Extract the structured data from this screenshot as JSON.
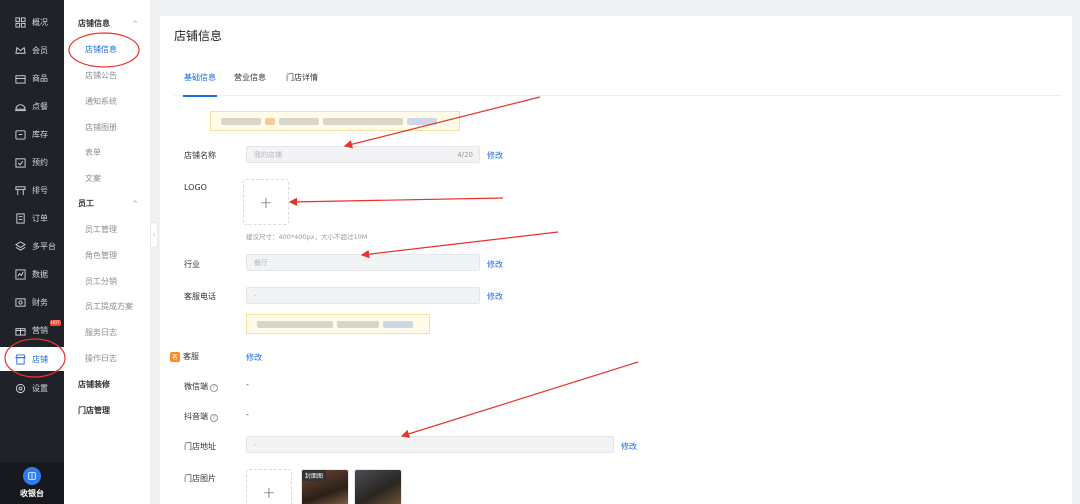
{
  "rail": {
    "items": [
      {
        "label": "概况",
        "icon": "grid-icon"
      },
      {
        "label": "会员",
        "icon": "crown-icon"
      },
      {
        "label": "商品",
        "icon": "box-icon"
      },
      {
        "label": "点餐",
        "icon": "dish-icon"
      },
      {
        "label": "库存",
        "icon": "warehouse-icon"
      },
      {
        "label": "预约",
        "icon": "calendar-check-icon"
      },
      {
        "label": "排号",
        "icon": "queue-icon"
      },
      {
        "label": "订单",
        "icon": "order-icon"
      },
      {
        "label": "多平台",
        "icon": "layers-icon"
      },
      {
        "label": "数据",
        "icon": "chart-icon"
      },
      {
        "label": "财务",
        "icon": "money-icon"
      },
      {
        "label": "营销",
        "icon": "gift-icon",
        "badge": "HOT"
      },
      {
        "label": "店铺",
        "icon": "store-icon",
        "active": true
      },
      {
        "label": "设置",
        "icon": "gear-icon"
      }
    ],
    "cashier_label": "收银台"
  },
  "submenu": {
    "group1": "店铺信息",
    "group1_items": [
      "店铺信息",
      "店铺公告",
      "通知系统",
      "店铺图册",
      "表单",
      "文案"
    ],
    "group2": "员工",
    "group2_items": [
      "员工管理",
      "角色管理",
      "员工分销",
      "员工提成方案",
      "服务日志",
      "操作日志"
    ],
    "extra": [
      "店铺装修",
      "门店管理"
    ]
  },
  "page": {
    "title": "店铺信息",
    "tabs": [
      "基础信息",
      "营业信息",
      "门店详情"
    ]
  },
  "form": {
    "store_name_label": "店铺名称",
    "store_name_placeholder": "我的店铺",
    "store_name_count": "4/20",
    "edit_label": "修改",
    "logo_label": "LOGO",
    "upload_plus": "+",
    "logo_hint": "建议尺寸：400*400px，大小不超过10M",
    "industry_label": "行业",
    "industry_value": "餐厅",
    "phone_label": "客服电话",
    "phone_value": "-",
    "service_section": "客服",
    "wechat_label": "微信端",
    "wechat_value": "-",
    "douyin_label": "抖音端",
    "douyin_value": "-",
    "address_label": "门店地址",
    "address_value": "-",
    "photos_label": "门店图片",
    "cover_tag": "封面图",
    "help_mark": "?",
    "section_icon": "客"
  },
  "colors": {
    "accent": "#1d6ae5",
    "rail_bg": "#1f2229",
    "annotation_red": "#e8322a",
    "notice_bg": "#fffbe8"
  }
}
